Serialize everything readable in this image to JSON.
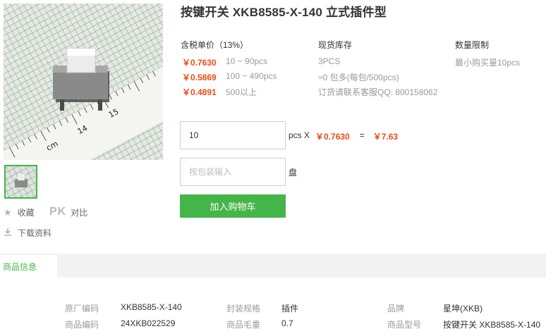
{
  "product": {
    "title": "按键开关 XKB8585-X-140 立式插件型"
  },
  "gallery": {
    "main_image": "product photo: grey square push button switch on green measuring grid with ruler",
    "thumbnail_image": "product thumbnail"
  },
  "side_actions": {
    "favorite_label": "收藏",
    "pk_label": "PK",
    "compare_label": "对比",
    "download_label": "下载资料"
  },
  "pricing": {
    "header": "含税单价（13%）",
    "tiers": [
      {
        "price": "￥0.7630",
        "range": "10 ~ 90pcs"
      },
      {
        "price": "￥0.5869",
        "range": "100 ~ 490pcs"
      },
      {
        "price": "￥0.4891",
        "range": "500以上"
      }
    ]
  },
  "stock": {
    "header": "现货库存",
    "quantity": "3PCS",
    "package": "≈0 包多(每包/500pcs)",
    "contact": "订货请联系客服QQ: 800158062"
  },
  "limit": {
    "header": "数量限制",
    "min": "最小购买量10pcs"
  },
  "order": {
    "qty_value": "10",
    "unit_label": "pcs X",
    "unit_price": "￥0.7630",
    "equals": "=",
    "total": "￥7.63",
    "pack_placeholder": "按包装输入",
    "pack_unit": "盘",
    "add_to_cart": "加入购物车"
  },
  "tabs": {
    "active": "商品信息"
  },
  "attributes": [
    {
      "key": "原厂编码",
      "value": "XKB8585-X-140"
    },
    {
      "key": "封装规格",
      "value": "插件"
    },
    {
      "key": "品牌",
      "value": "星坤(XKB)"
    },
    {
      "key": "商品编码",
      "value": "24XKB022529"
    },
    {
      "key": "商品毛重",
      "value": "0.7"
    },
    {
      "key": "商品型号",
      "value": "按键开关 XKB8585-X-140"
    }
  ],
  "colors": {
    "accent_green": "#44b549",
    "price_orange": "#f04b12",
    "muted_text": "#999999"
  }
}
